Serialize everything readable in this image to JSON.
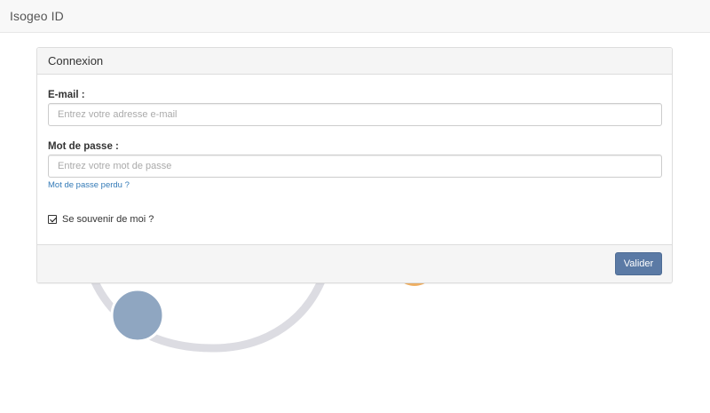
{
  "navbar": {
    "brand": "Isogeo ID"
  },
  "panel": {
    "heading": "Connexion",
    "email": {
      "label": "E-mail :",
      "placeholder": "Entrez votre adresse e-mail",
      "value": ""
    },
    "password": {
      "label": "Mot de passe :",
      "placeholder": "Entrez votre mot de passe",
      "value": ""
    },
    "forgot_link": "Mot de passe perdu ?",
    "remember": {
      "label": "Se souvenir de moi ?",
      "checked": true
    },
    "submit_label": "Valider"
  },
  "colors": {
    "primary_button": "#5b7aa5",
    "link": "#337ab7",
    "art_blue": "#8fa6c1",
    "art_ring": "#dcdce2",
    "art_orange": "#f0b267"
  }
}
